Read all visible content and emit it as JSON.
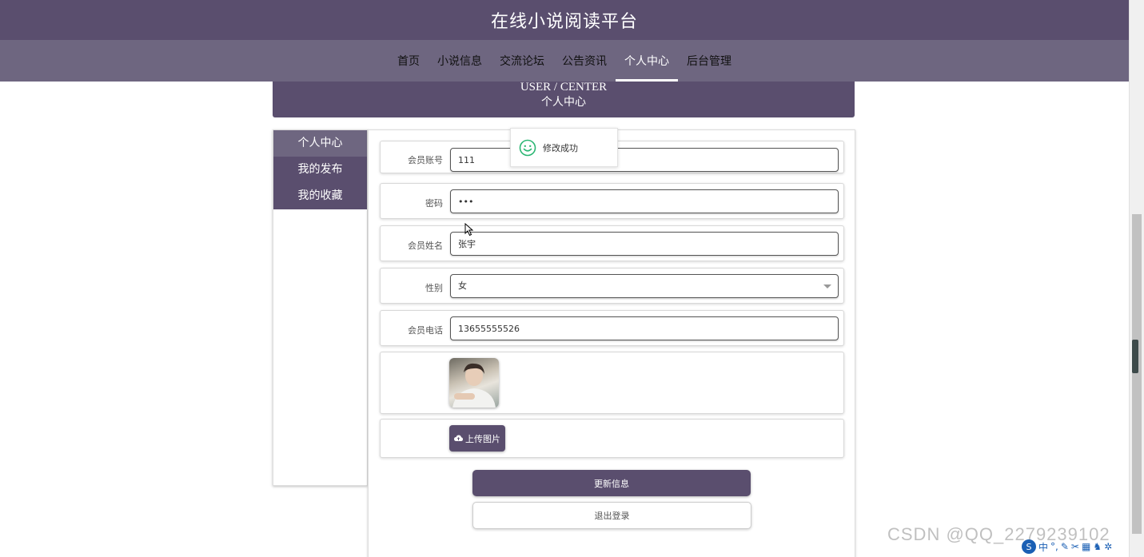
{
  "header": {
    "site_title": "在线小说阅读平台"
  },
  "nav": {
    "items": [
      {
        "label": "首页"
      },
      {
        "label": "小说信息"
      },
      {
        "label": "交流论坛"
      },
      {
        "label": "公告资讯"
      },
      {
        "label": "个人中心",
        "active": true
      },
      {
        "label": "后台管理"
      }
    ]
  },
  "banner": {
    "en": "USER / CENTER",
    "cn": "个人中心"
  },
  "sidebar": {
    "items": [
      {
        "label": "个人中心",
        "active": true
      },
      {
        "label": "我的发布"
      },
      {
        "label": "我的收藏"
      }
    ]
  },
  "form": {
    "account": {
      "label": "会员账号",
      "value": "111"
    },
    "password": {
      "label": "密码",
      "value": "•••"
    },
    "name": {
      "label": "会员姓名",
      "value": "张宇"
    },
    "gender": {
      "label": "性别",
      "value": "女"
    },
    "phone": {
      "label": "会员电话",
      "value": "13655555526"
    },
    "upload_label": "上传图片",
    "update_label": "更新信息",
    "logout_label": "退出登录"
  },
  "toast": {
    "message": "修改成功"
  },
  "watermark": {
    "text": "CSDN @QQ_2279239102"
  },
  "ime": {
    "lang": "中"
  },
  "colors": {
    "primary": "#5a4e6e",
    "nav_bg": "#6e6680",
    "success": "#2bb673"
  }
}
